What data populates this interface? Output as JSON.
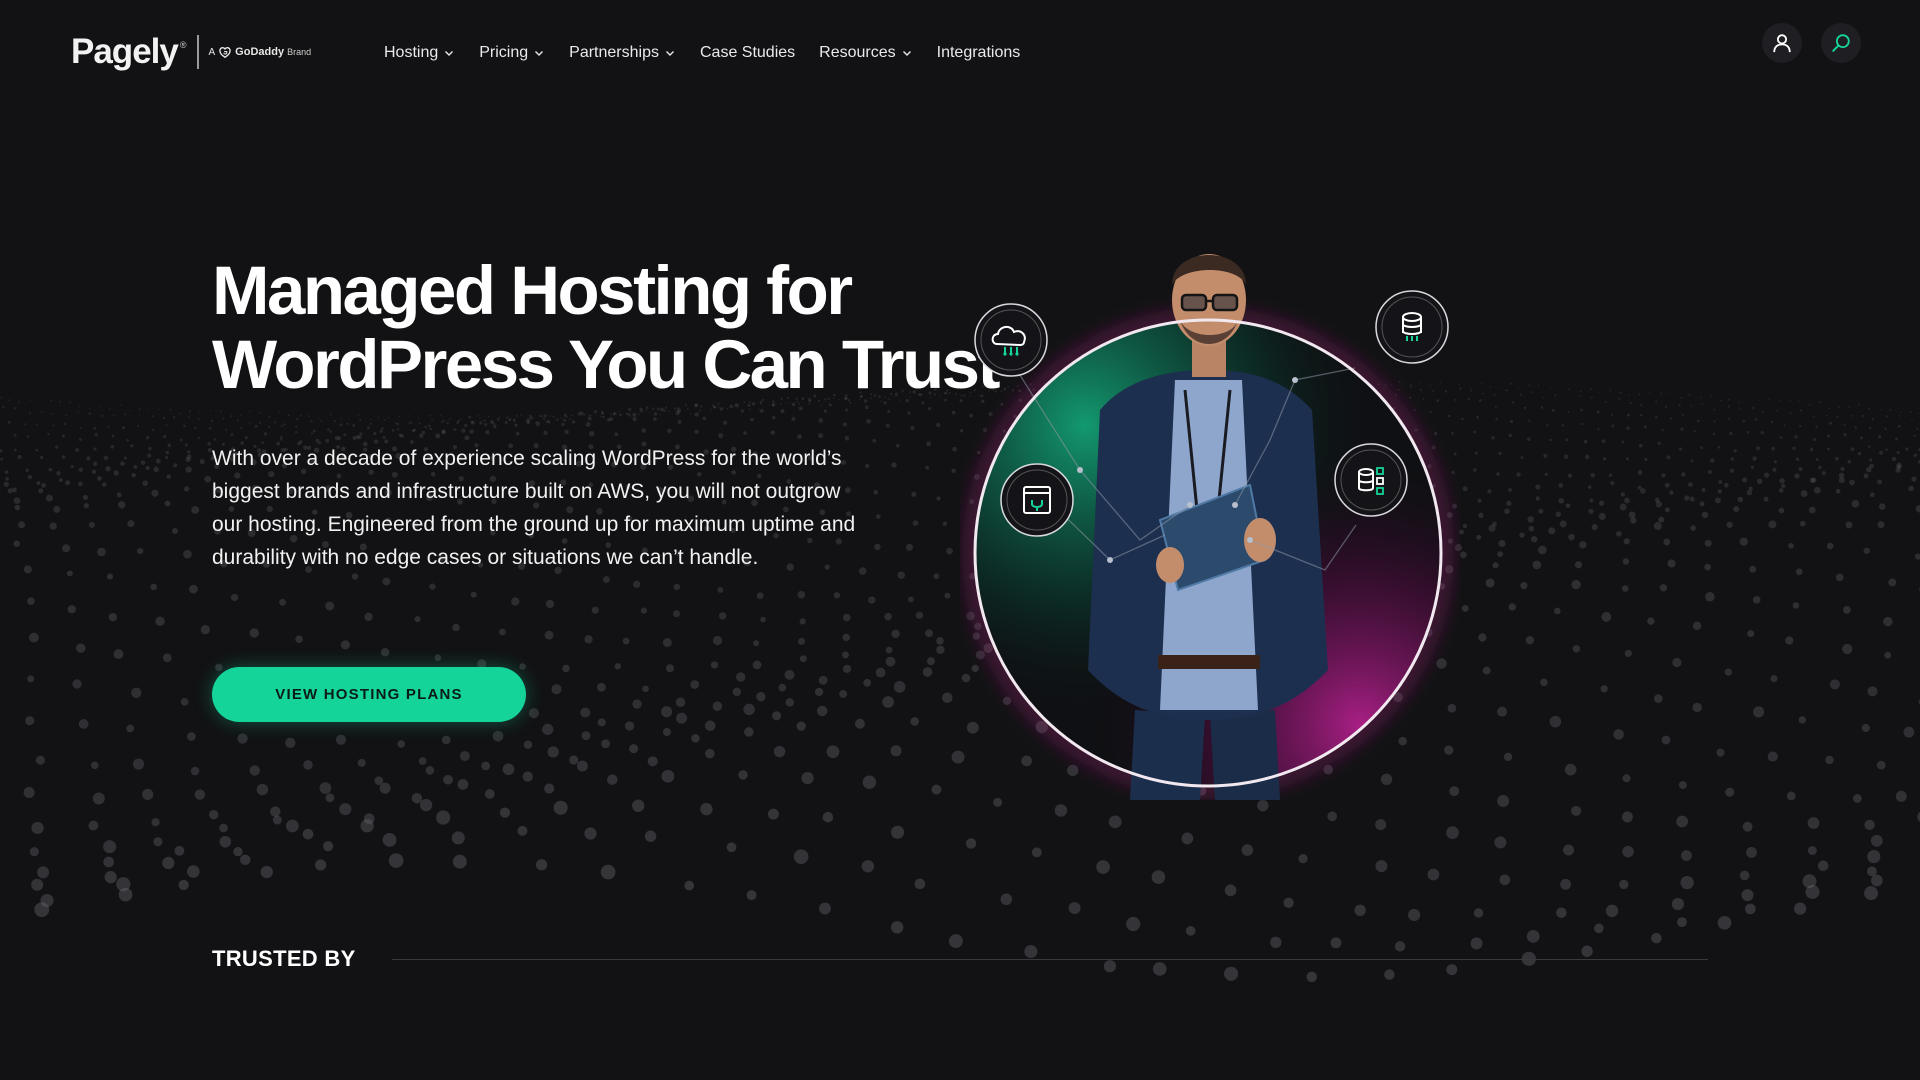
{
  "brand": {
    "logo_text": "Pagely",
    "registered": "®",
    "parent_prefix": "A",
    "parent_name": "GoDaddy",
    "parent_suffix": "Brand"
  },
  "nav": {
    "items": [
      {
        "label": "Hosting",
        "has_dropdown": true
      },
      {
        "label": "Pricing",
        "has_dropdown": true
      },
      {
        "label": "Partnerships",
        "has_dropdown": true
      },
      {
        "label": "Case Studies",
        "has_dropdown": false
      },
      {
        "label": "Resources",
        "has_dropdown": true
      },
      {
        "label": "Integrations",
        "has_dropdown": false
      }
    ]
  },
  "header_actions": {
    "account_icon": "user-icon",
    "search_icon": "search-icon"
  },
  "hero": {
    "title_line1": "Managed Hosting for",
    "title_line2": "WordPress You Can Trust",
    "description": "With over a decade of experience scaling WordPress for the world’s biggest brands and infrastructure built on AWS, you will not outgrow our hosting. Engineered from the ground up for maximum uptime and durability with no edge cases or situations we can’t handle.",
    "cta_label": "VIEW HOSTING PLANS",
    "visual_icons": [
      "cloud-icon",
      "database-icon",
      "browser-plug-icon",
      "server-stack-icon"
    ]
  },
  "trusted": {
    "label": "TRUSTED BY"
  },
  "colors": {
    "background": "#121214",
    "accent": "#15d49a",
    "ring_glow_magenta": "#b0208a",
    "ring_glow_green": "#0fa37a",
    "text": "#ffffff"
  }
}
